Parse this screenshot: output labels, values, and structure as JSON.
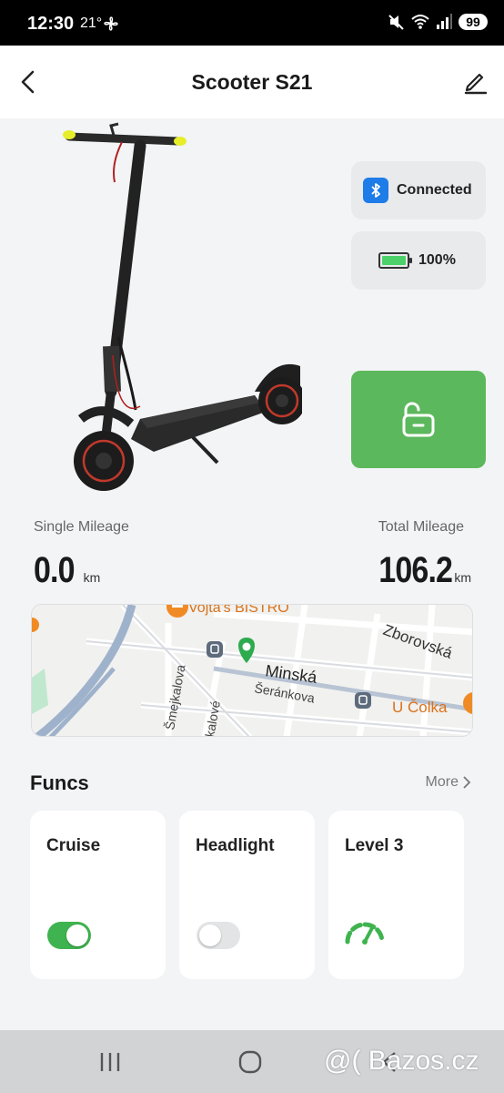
{
  "status_bar": {
    "time": "12:30",
    "temperature": "21°",
    "battery": "99"
  },
  "header": {
    "title": "Scooter S21"
  },
  "status": {
    "connection": "Connected",
    "battery": "100%",
    "battery_level": 1.0
  },
  "mileage": {
    "single_label": "Single Mileage",
    "single_value": "0.0",
    "single_unit": "km",
    "total_label": "Total Mileage",
    "total_value": "106.2",
    "total_unit": "km"
  },
  "map": {
    "labels": [
      "Vojta's BISTRO",
      "Zborovská",
      "Minská",
      "Šmejkalova",
      "Šeránkova",
      "U Čolka",
      "kalové"
    ]
  },
  "funcs": {
    "title": "Funcs",
    "more": "More",
    "items": [
      {
        "label": "Cruise",
        "control": "toggle",
        "on": true
      },
      {
        "label": "Headlight",
        "control": "toggle",
        "on": false
      },
      {
        "label": "Level 3",
        "control": "gauge-icon"
      }
    ]
  },
  "watermark": "@( Bazos.cz",
  "colors": {
    "accent_green": "#5cb85c",
    "toggle_green": "#3fb34f",
    "bluetooth_blue": "#1e7ce8"
  }
}
